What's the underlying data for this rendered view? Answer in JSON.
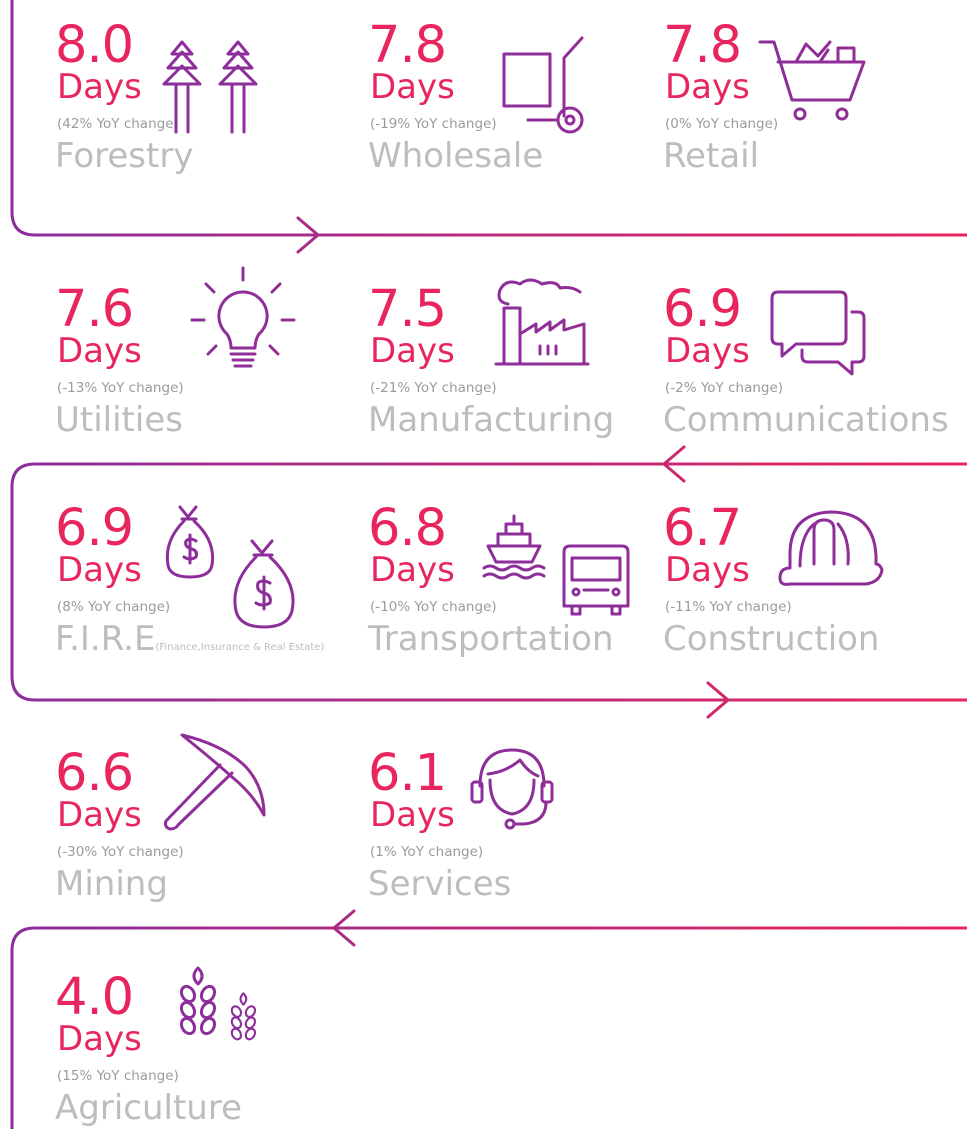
{
  "unit": "Days",
  "colors": {
    "accent": "#e8265d",
    "purple": "#8a2e9c",
    "label": "#bdbdbd",
    "change": "#9b9b9b"
  },
  "industries": [
    {
      "value": "8.0",
      "change": "(42% YoY change)",
      "name": "Forestry",
      "icon": "pine-trees-icon"
    },
    {
      "value": "7.8",
      "change": "(-19% YoY change)",
      "name": "Wholesale",
      "icon": "hand-truck-icon"
    },
    {
      "value": "7.8",
      "change": "(0% YoY change)",
      "name": "Retail",
      "icon": "shopping-cart-icon"
    },
    {
      "value": "7.6",
      "change": "(-13% YoY change)",
      "name": "Utilities",
      "icon": "light-bulb-icon"
    },
    {
      "value": "7.5",
      "change": "(-21% YoY change)",
      "name": "Manufacturing",
      "icon": "factory-icon"
    },
    {
      "value": "6.9",
      "change": "(-2% YoY change)",
      "name": "Communications",
      "icon": "chat-bubbles-icon"
    },
    {
      "value": "6.9",
      "change": "(8% YoY change)",
      "name": "F.I.R.E",
      "name_note": "(Finance,Insurance & Real Estate)",
      "icon": "money-bags-icon"
    },
    {
      "value": "6.8",
      "change": "(-10% YoY change)",
      "name": "Transportation",
      "icon": "ship-truck-icon"
    },
    {
      "value": "6.7",
      "change": "(-11% YoY change)",
      "name": "Construction",
      "icon": "hard-hat-icon"
    },
    {
      "value": "6.6",
      "change": "(-30% YoY change)",
      "name": "Mining",
      "icon": "pickaxe-icon"
    },
    {
      "value": "6.1",
      "change": "(1% YoY change)",
      "name": "Services",
      "icon": "headset-icon"
    },
    {
      "value": "4.0",
      "change": "(15% YoY change)",
      "name": "Agriculture",
      "icon": "wheat-icon"
    }
  ]
}
